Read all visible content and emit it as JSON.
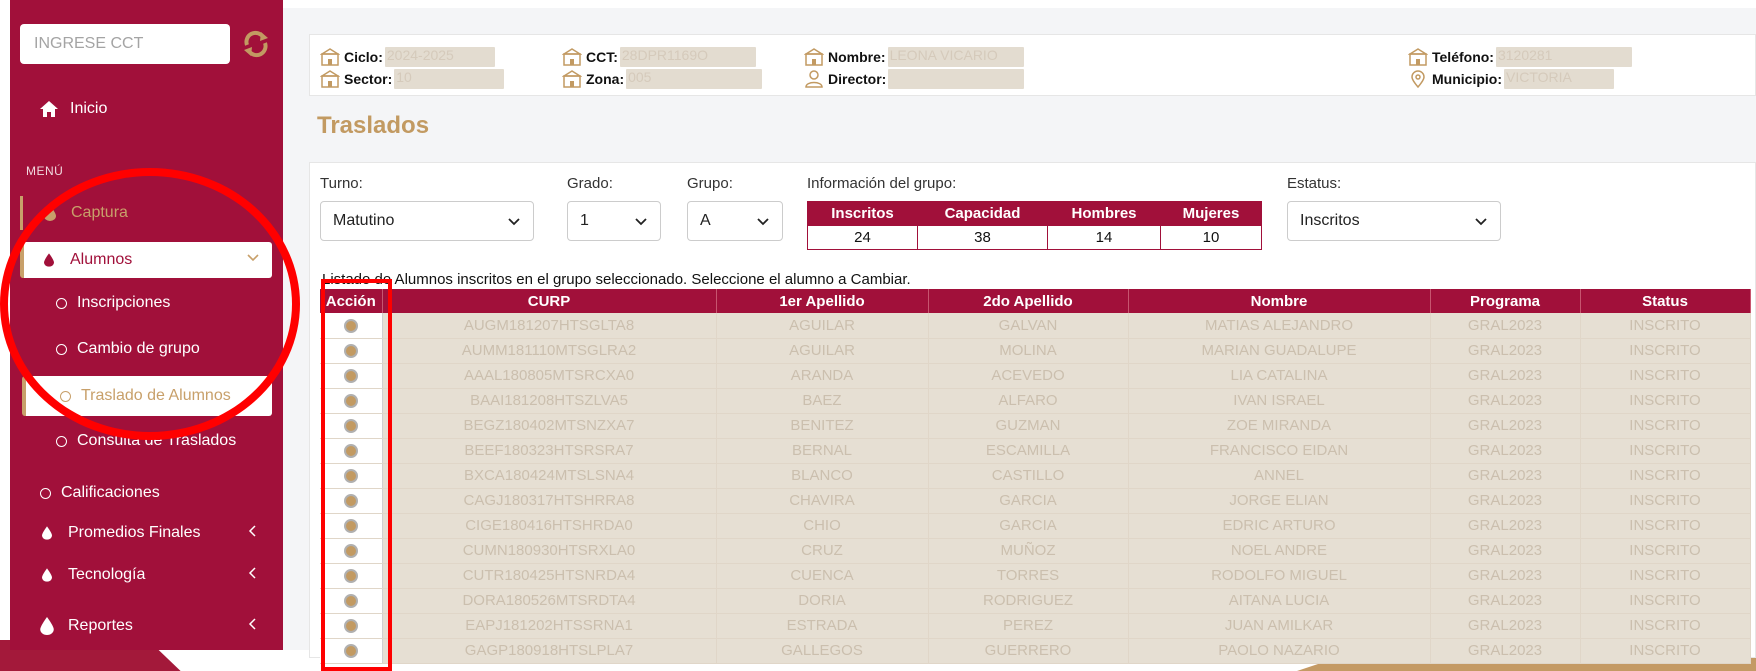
{
  "sidebar": {
    "cct_placeholder": "INGRESE CCT",
    "inicio": "Inicio",
    "menu_label": "MENÚ",
    "captura": "Captura",
    "alumnos": "Alumnos",
    "sub_items": [
      "Inscripciones",
      "Cambio de grupo",
      "Traslado de Alumnos",
      "Consulta de Traslados"
    ],
    "calificaciones": "Calificaciones",
    "promedios": "Promedios Finales",
    "tecnologia": "Tecnología",
    "reportes": "Reportes"
  },
  "info": {
    "ciclo_label": "Ciclo:",
    "ciclo_value": "2024-2025",
    "sector_label": "Sector:",
    "sector_value": "10",
    "cct_label": "CCT:",
    "cct_value": "28DPR1169O",
    "zona_label": "Zona:",
    "zona_value": "005",
    "nombre_label": "Nombre:",
    "nombre_value": "LEONA VICARIO",
    "director_label": "Director:",
    "director_value": "",
    "telefono_label": "Teléfono:",
    "telefono_value": "3120281",
    "municipio_label": "Municipio:",
    "municipio_value": "VICTORIA"
  },
  "page_title": "Traslados",
  "filters": {
    "turno_label": "Turno:",
    "turno_value": "Matutino",
    "grado_label": "Grado:",
    "grado_value": "1",
    "grupo_label": "Grupo:",
    "grupo_value": "A",
    "info_label": "Información del grupo:",
    "estatus_label": "Estatus:",
    "estatus_value": "Inscritos"
  },
  "group_info": {
    "headers": [
      "Inscritos",
      "Capacidad",
      "Hombres",
      "Mujeres"
    ],
    "values": [
      "24",
      "38",
      "14",
      "10"
    ]
  },
  "list_caption": "Listado de Alumnos inscritos en el grupo seleccionado. Seleccione el alumno a Cambiar.",
  "students": {
    "headers": [
      "Acción",
      "CURP",
      "1er Apellido",
      "2do Apellido",
      "Nombre",
      "Programa",
      "Status"
    ],
    "rows": [
      [
        "AUGM181207HTSGLTA8",
        "AGUILAR",
        "GALVAN",
        "MATIAS ALEJANDRO",
        "GRAL2023",
        "INSCRITO"
      ],
      [
        "AUMM181110MTSGLRA2",
        "AGUILAR",
        "MOLINA",
        "MARIAN GUADALUPE",
        "GRAL2023",
        "INSCRITO"
      ],
      [
        "AAAL180805MTSRCXA0",
        "ARANDA",
        "ACEVEDO",
        "LIA CATALINA",
        "GRAL2023",
        "INSCRITO"
      ],
      [
        "BAAI181208HTSZLVA5",
        "BAEZ",
        "ALFARO",
        "IVAN ISRAEL",
        "GRAL2023",
        "INSCRITO"
      ],
      [
        "BEGZ180402MTSNZXA7",
        "BENITEZ",
        "GUZMAN",
        "ZOE MIRANDA",
        "GRAL2023",
        "INSCRITO"
      ],
      [
        "BEEF180323HTSRSRA7",
        "BERNAL",
        "ESCAMILLA",
        "FRANCISCO EIDAN",
        "GRAL2023",
        "INSCRITO"
      ],
      [
        "BXCA180424MTSLSNA4",
        "BLANCO",
        "CASTILLO",
        "ANNEL",
        "GRAL2023",
        "INSCRITO"
      ],
      [
        "CAGJ180317HTSHRRA8",
        "CHAVIRA",
        "GARCIA",
        "JORGE ELIAN",
        "GRAL2023",
        "INSCRITO"
      ],
      [
        "CIGE180416HTSHRDA0",
        "CHIO",
        "GARCIA",
        "EDRIC ARTURO",
        "GRAL2023",
        "INSCRITO"
      ],
      [
        "CUMN180930HTSRXLA0",
        "CRUZ",
        "MUÑOZ",
        "NOEL ANDRE",
        "GRAL2023",
        "INSCRITO"
      ],
      [
        "CUTR180425HTSNRDA4",
        "CUENCA",
        "TORRES",
        "RODOLFO MIGUEL",
        "GRAL2023",
        "INSCRITO"
      ],
      [
        "DORA180526MTSRDTA4",
        "DORIA",
        "RODRIGUEZ",
        "AITANA LUCIA",
        "GRAL2023",
        "INSCRITO"
      ],
      [
        "EAPJ181202HTSSRNA1",
        "ESTRADA",
        "PEREZ",
        "JUAN AMILKAR",
        "GRAL2023",
        "INSCRITO"
      ],
      [
        "GAGP180918HTSLPLA7",
        "GALLEGOS",
        "GUERRERO",
        "PAOLO NAZARIO",
        "GRAL2023",
        "INSCRITO"
      ]
    ]
  },
  "colors": {
    "primary": "#a1103a",
    "accent": "#c29a62",
    "highlight": "#ff0000"
  }
}
